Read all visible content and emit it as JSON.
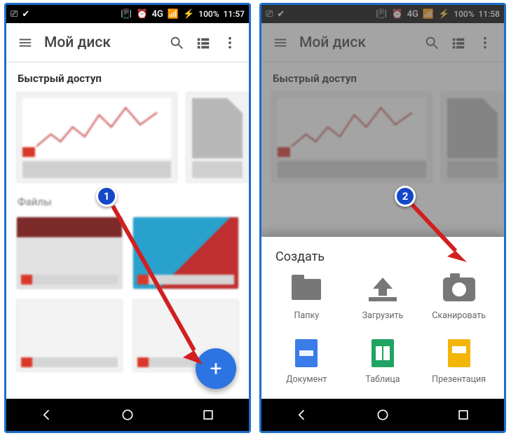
{
  "statusbar": {
    "battery_pct": "100%",
    "time_left": "11:57",
    "time_right": "11:58",
    "network_label": "4G"
  },
  "appbar": {
    "title": "Мой диск"
  },
  "sections": {
    "quick_access": "Быстрый доступ",
    "files": "Файлы"
  },
  "fab": {
    "glyph": "+"
  },
  "sheet": {
    "title": "Создать",
    "items": [
      {
        "id": "folder",
        "label": "Папку"
      },
      {
        "id": "upload",
        "label": "Загрузить"
      },
      {
        "id": "scan",
        "label": "Сканировать"
      },
      {
        "id": "doc",
        "label": "Документ"
      },
      {
        "id": "sheet",
        "label": "Таблица"
      },
      {
        "id": "slides",
        "label": "Презентация"
      }
    ]
  },
  "badges": {
    "one": "1",
    "two": "2"
  }
}
